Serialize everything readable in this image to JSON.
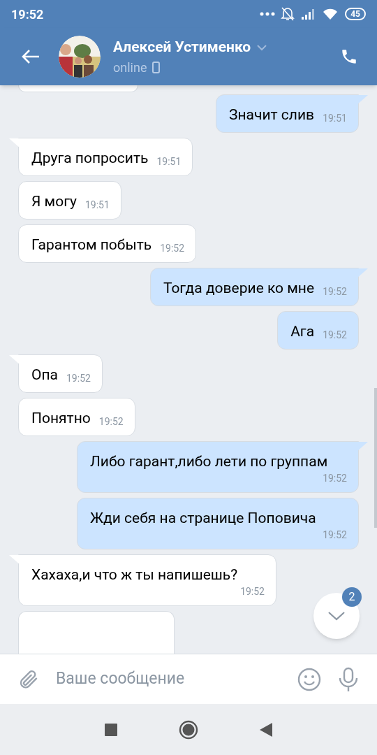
{
  "status_bar": {
    "time": "19:52",
    "battery": "45"
  },
  "header": {
    "name": "Алексей Устименко",
    "presence": "online"
  },
  "messages": [
    {
      "kind": "incoming_partial"
    },
    {
      "kind": "outgoing",
      "text": "Значит слив",
      "time": "19:51",
      "tail": true
    },
    {
      "kind": "incoming",
      "text": "Друга попросить",
      "time": "19:51",
      "tail": true
    },
    {
      "kind": "incoming",
      "text": "Я могу",
      "time": "19:51",
      "tail": false
    },
    {
      "kind": "incoming",
      "text": "Гарантом побыть",
      "time": "19:52",
      "tail": false
    },
    {
      "kind": "outgoing",
      "text": "Тогда доверие ко мне",
      "time": "19:52",
      "tail": true
    },
    {
      "kind": "outgoing",
      "text": "Ага",
      "time": "19:52",
      "tail": false
    },
    {
      "kind": "incoming",
      "text": "Опа",
      "time": "19:52",
      "tail": true
    },
    {
      "kind": "incoming",
      "text": "Понятно",
      "time": "19:52",
      "tail": false
    },
    {
      "kind": "outgoing",
      "text": "Либо гарант,либо лети по группам",
      "time": "19:52",
      "tail": true
    },
    {
      "kind": "outgoing",
      "text": "Жди себя на странице Поповича",
      "time": "19:52",
      "tail": false
    },
    {
      "kind": "incoming",
      "text": "Хахаха,и что ж ты напишешь?",
      "time": "19:52",
      "tail": true
    },
    {
      "kind": "incoming_partial"
    }
  ],
  "scroll_button": {
    "badge": "2"
  },
  "composer": {
    "placeholder": "Ваше сообщение"
  }
}
